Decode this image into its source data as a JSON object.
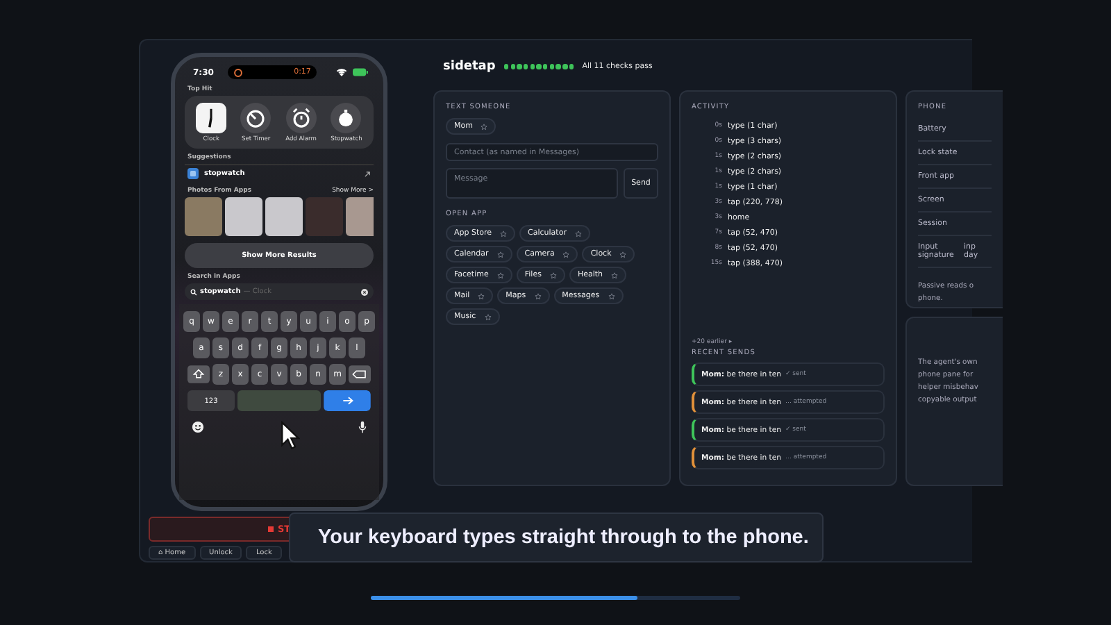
{
  "phone": {
    "status": {
      "time": "7:30",
      "timer": "0:17"
    },
    "top_hit": {
      "title": "Top Hit",
      "apps": [
        {
          "label": "Clock",
          "kind": "clock"
        },
        {
          "label": "Set Timer",
          "kind": "timer"
        },
        {
          "label": "Add Alarm",
          "kind": "alarm"
        },
        {
          "label": "Stopwatch",
          "kind": "stopwatch"
        }
      ]
    },
    "suggestions": {
      "title": "Suggestions",
      "item": "stopwatch"
    },
    "photos": {
      "title": "Photos From Apps",
      "more": "Show More >"
    },
    "show_more_results": "Show More Results",
    "search_in_apps": "Search in Apps",
    "search": {
      "value": "stopwatch",
      "completion": "— Clock"
    },
    "keyboard": {
      "rows": [
        [
          "q",
          "w",
          "e",
          "r",
          "t",
          "y",
          "u",
          "i",
          "o",
          "p"
        ],
        [
          "a",
          "s",
          "d",
          "f",
          "g",
          "h",
          "j",
          "k",
          "l"
        ],
        [
          "z",
          "x",
          "c",
          "v",
          "b",
          "n",
          "m"
        ]
      ],
      "numbers": "123"
    }
  },
  "stop_button": "ST",
  "controls": [
    "⌂ Home",
    "Unlock",
    "Lock"
  ],
  "header": {
    "title": "sidetap",
    "checks": [
      {
        "passed": true
      },
      {
        "passed": true
      },
      {
        "passed": true
      },
      {
        "passed": true
      },
      {
        "passed": true
      },
      {
        "passed": true
      },
      {
        "passed": true
      },
      {
        "passed": true
      },
      {
        "passed": true
      },
      {
        "passed": true
      },
      {
        "passed": true
      }
    ],
    "summary": "All 11 checks pass"
  },
  "text_someone": {
    "title": "TEXT SOMEONE",
    "favorites": [
      "Mom"
    ],
    "contact_placeholder": "Contact (as named in Messages)",
    "message_placeholder": "Message",
    "send": "Send"
  },
  "open_app": {
    "title": "OPEN APP",
    "apps": [
      "App Store",
      "Calculator",
      "Calendar",
      "Camera",
      "Clock",
      "Facetime",
      "Files",
      "Health",
      "Mail",
      "Maps",
      "Messages",
      "Music"
    ]
  },
  "activity": {
    "title": "ACTIVITY",
    "rows": [
      {
        "time": "0s",
        "action": "type (1 char)"
      },
      {
        "time": "0s",
        "action": "type (3 chars)"
      },
      {
        "time": "1s",
        "action": "type (2 chars)"
      },
      {
        "time": "1s",
        "action": "type (2 chars)"
      },
      {
        "time": "1s",
        "action": "type (1 char)"
      },
      {
        "time": "3s",
        "action": "tap (220, 778)"
      },
      {
        "time": "3s",
        "action": "home"
      },
      {
        "time": "7s",
        "action": "tap (52, 470)"
      },
      {
        "time": "8s",
        "action": "tap (52, 470)"
      },
      {
        "time": "15s",
        "action": "tap (388, 470)"
      }
    ],
    "earlier": "+20 earlier ▸"
  },
  "recent_sends": {
    "title": "RECENT SENDS",
    "items": [
      {
        "text": "**Mom:** be there in ten",
        "status": "✓ sent",
        "kind": "sent"
      },
      {
        "text": "**Mom:** be there in ten",
        "status": "… attempted",
        "kind": "attempted"
      },
      {
        "text": "**Mom:** be there in ten",
        "status": "✓ sent",
        "kind": "sent"
      },
      {
        "text": "**Mom:** be there in ten",
        "status": "… attempted",
        "kind": "attempted"
      }
    ]
  },
  "phone_panel": {
    "title": "PHONE",
    "rows": [
      {
        "label": "Battery"
      },
      {
        "label": "Lock state"
      },
      {
        "label": "Front app"
      },
      {
        "label": "Screen"
      },
      {
        "label": "Session"
      },
      {
        "label": "Input signature",
        "value": "inp day"
      }
    ],
    "note": [
      "Passive reads o",
      "phone."
    ]
  },
  "agent_card": {
    "lines": [
      "The agent's own",
      "phone pane for",
      "helper misbehav",
      "copyable output"
    ]
  },
  "caption": "Your keyboard types straight through to the phone.",
  "progress": {
    "level": 0.72
  }
}
